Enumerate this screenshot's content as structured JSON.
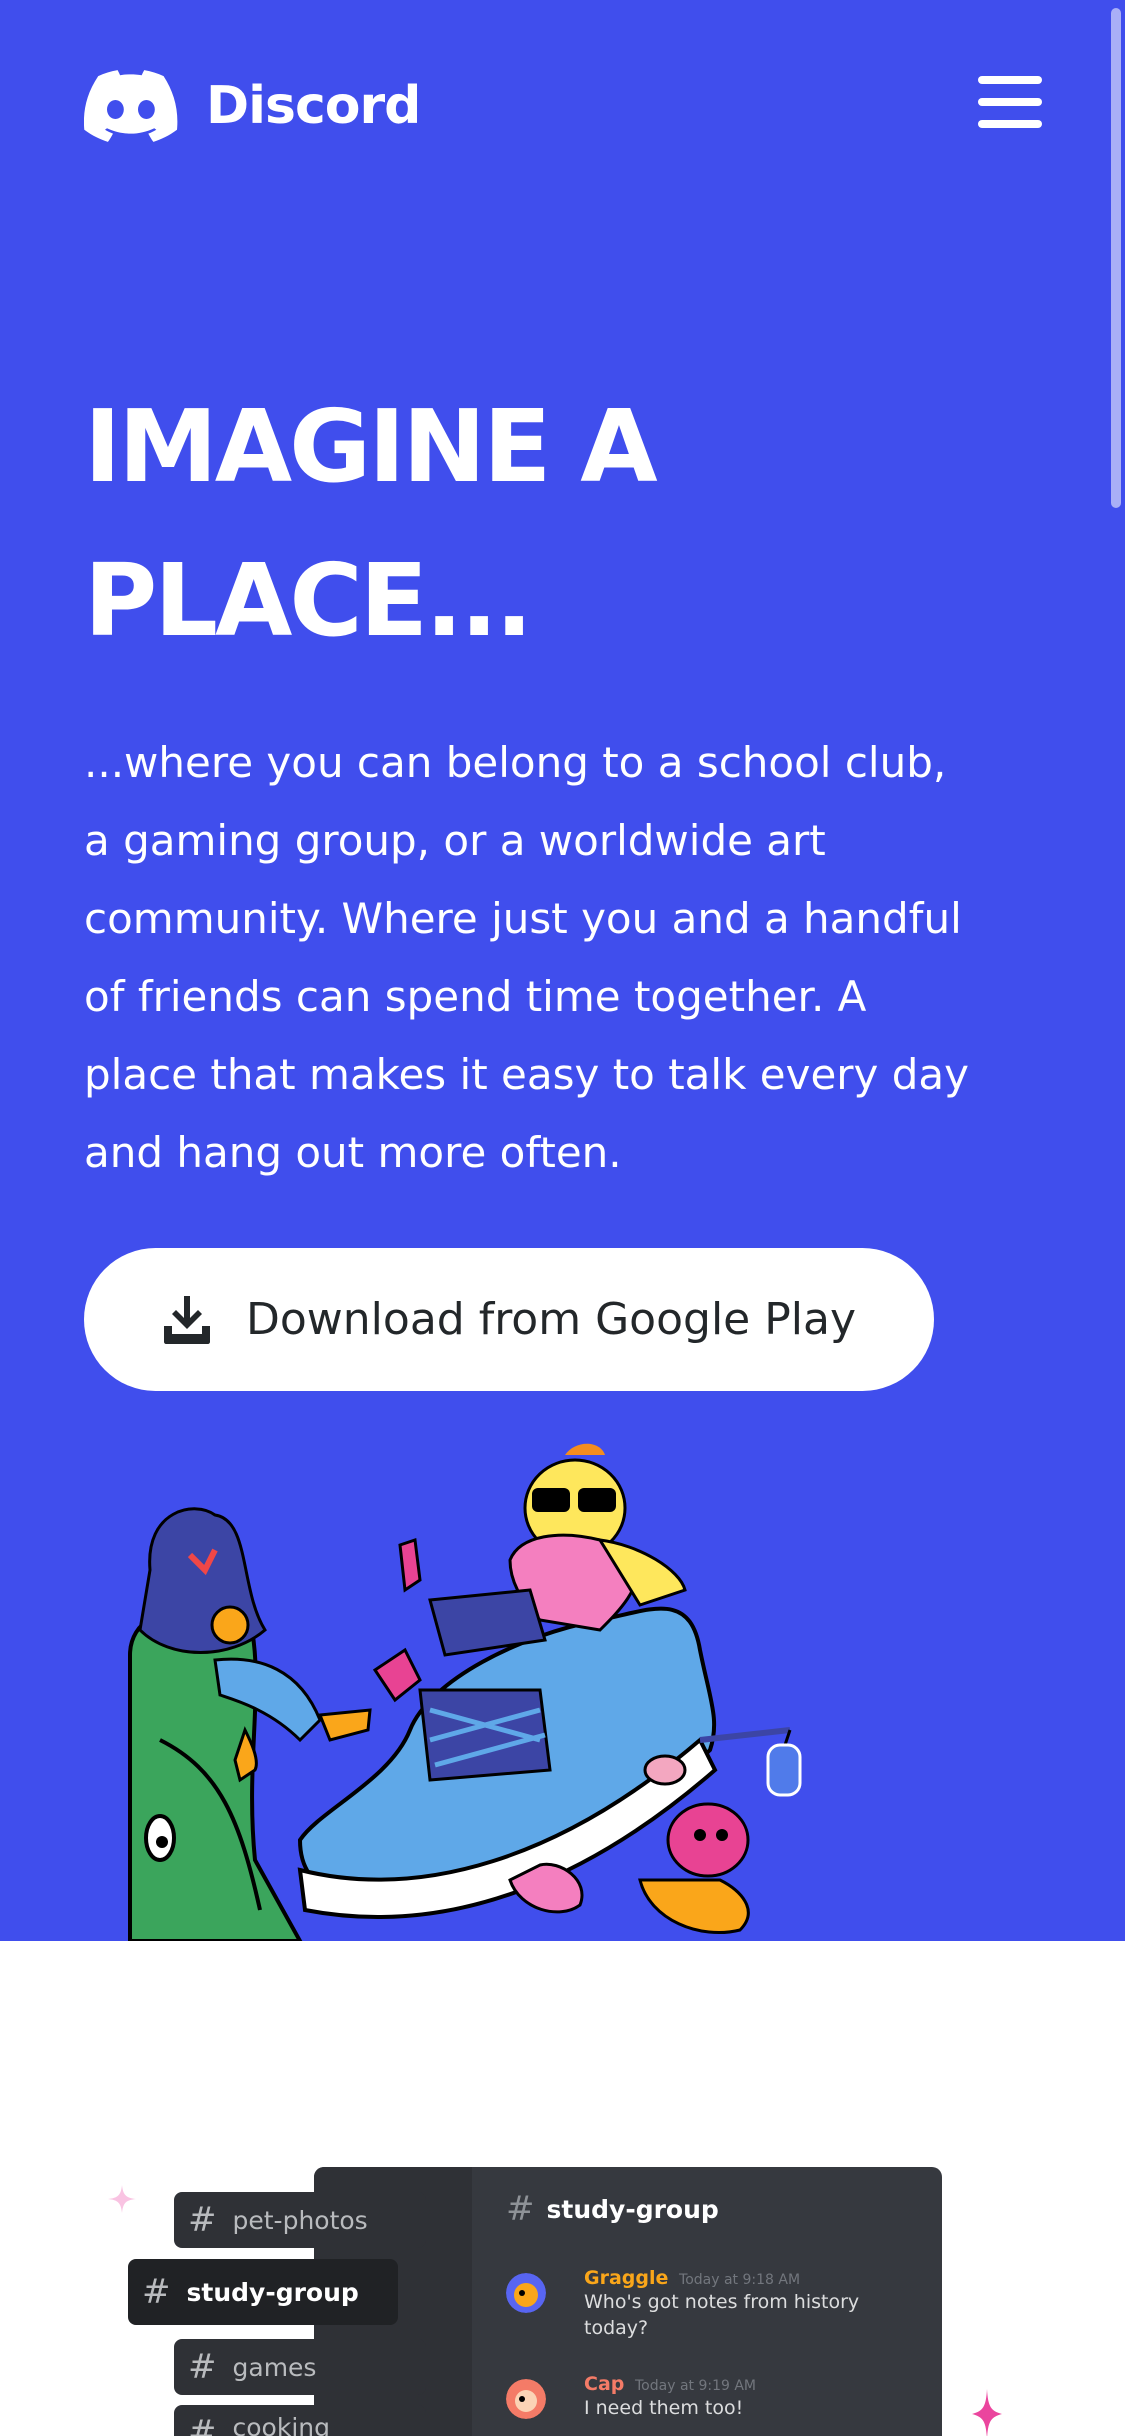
{
  "header": {
    "brand": "Discord",
    "logo_icon": "discord-logo-icon",
    "menu_icon": "hamburger-menu-icon"
  },
  "hero": {
    "headline": "IMAGINE A PLACE...",
    "intro": "...where you can belong to a school club, a gaming group, or a worldwide art community. Where just you and a handful of friends can spend time together. A place that makes it easy to talk every day and hang out more often.",
    "download_label": "Download from Google Play",
    "download_icon": "download-icon"
  },
  "chat_preview": {
    "channels": [
      {
        "name": "pet-photos",
        "active": false
      },
      {
        "name": "study-group",
        "active": true
      },
      {
        "name": "games",
        "active": false
      },
      {
        "name": "cooking",
        "active": false
      }
    ],
    "channel_title": "study-group",
    "messages": [
      {
        "author": "Graggle",
        "time": "Today at 9:18 AM",
        "text": "Who's got notes from history today?",
        "color": "#faa61a"
      },
      {
        "author": "Cap",
        "time": "Today at 9:19 AM",
        "text": "I need them too!",
        "color": "#f47b67"
      }
    ]
  },
  "colors": {
    "blurple": "#404eed",
    "white": "#ffffff",
    "dark_panel": "#36393f"
  }
}
